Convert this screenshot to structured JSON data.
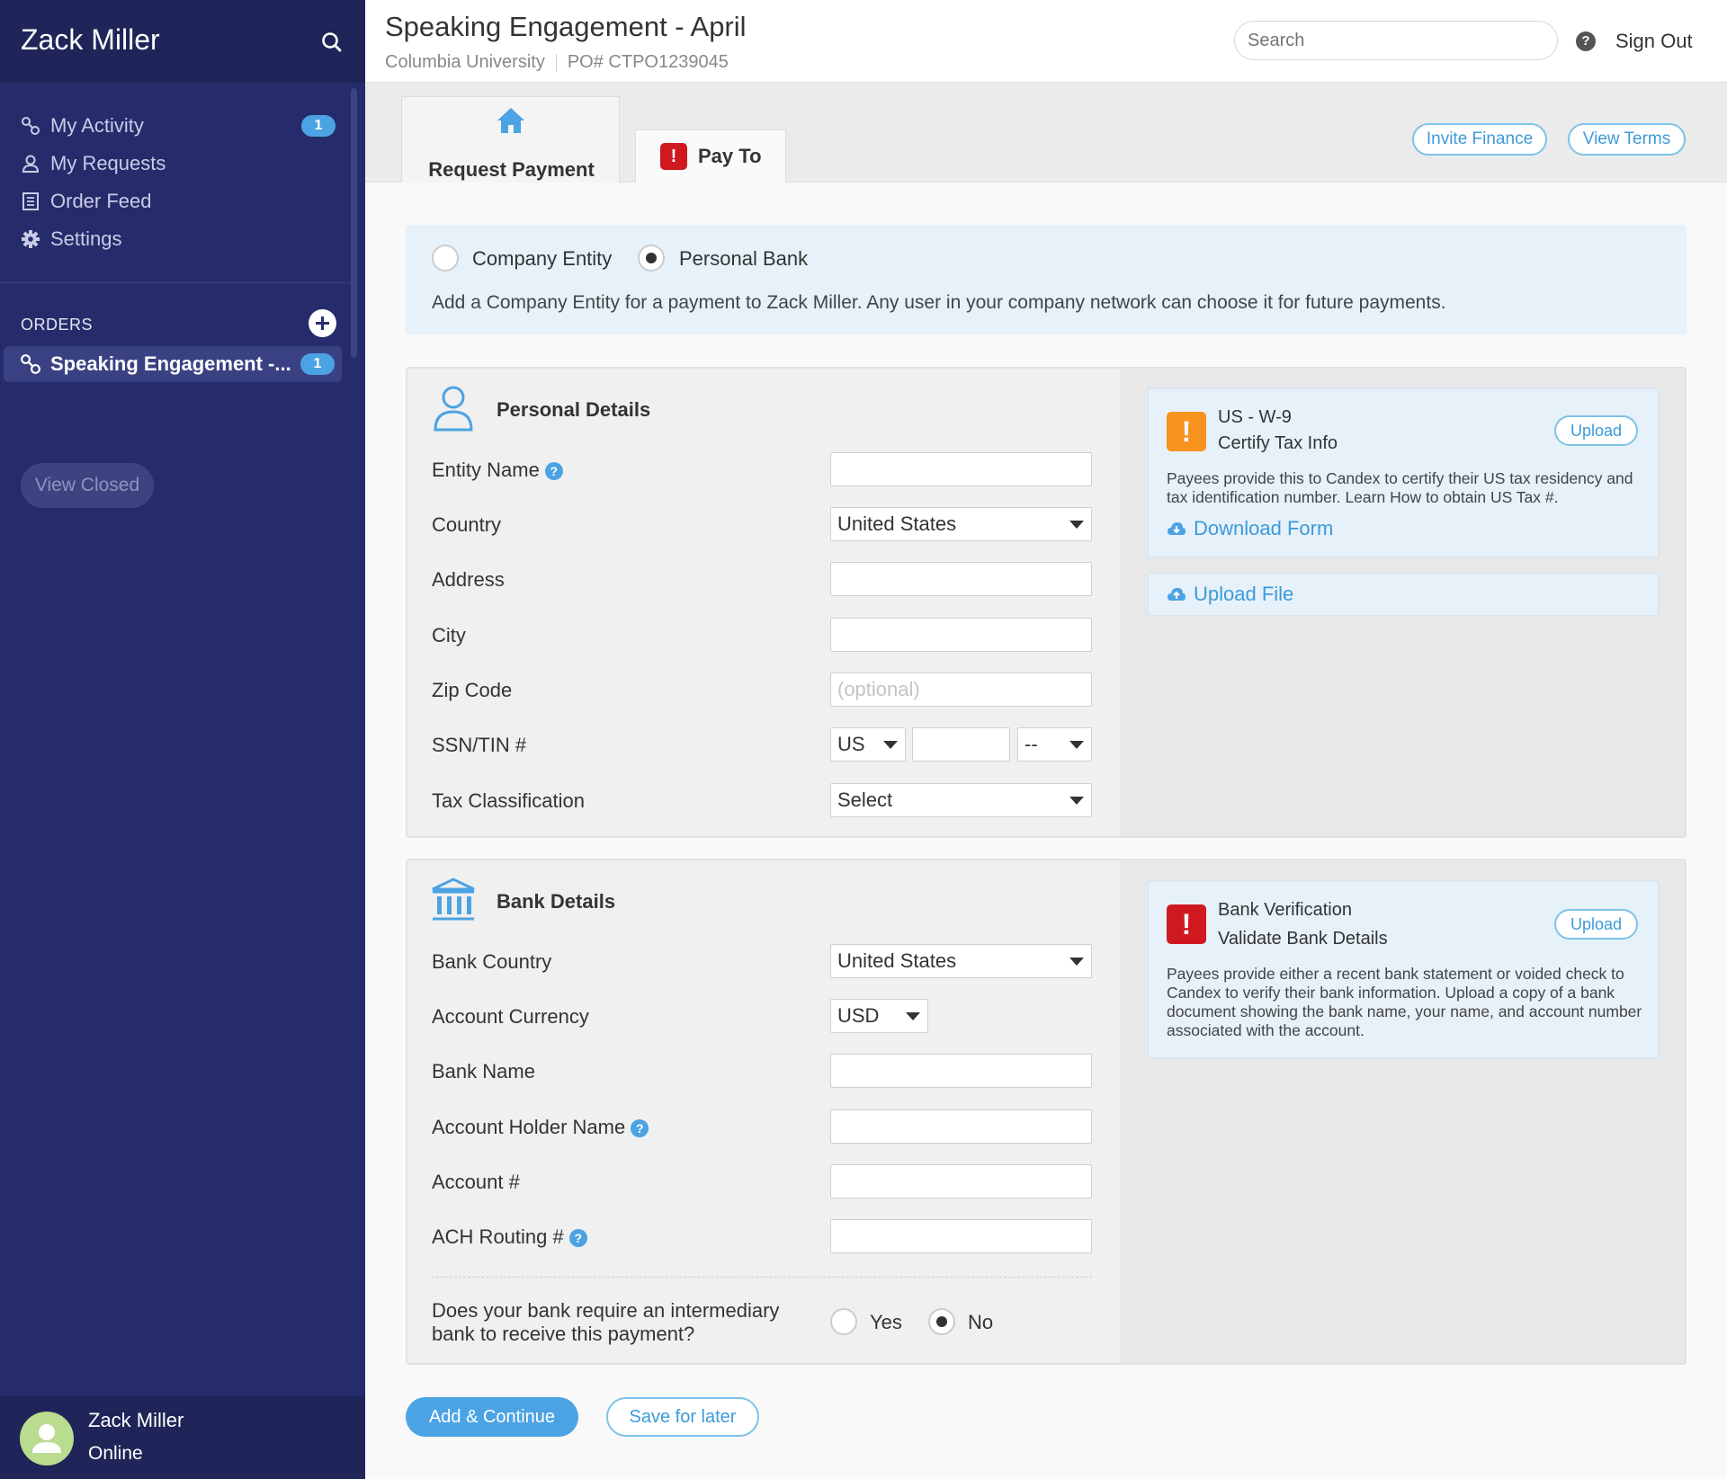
{
  "sidebar": {
    "user_name": "Zack Miller",
    "nav": [
      {
        "label": "My Activity",
        "icon": "link-icon",
        "badge": "1"
      },
      {
        "label": "My Requests",
        "icon": "user-icon"
      },
      {
        "label": "Order Feed",
        "icon": "list-icon"
      },
      {
        "label": "Settings",
        "icon": "gear-icon"
      }
    ],
    "orders_label": "ORDERS",
    "order_item": {
      "label": "Speaking Engagement -...",
      "badge": "1"
    },
    "view_closed": "View Closed",
    "footer": {
      "name": "Zack Miller",
      "status": "Online"
    }
  },
  "header": {
    "title": "Speaking Engagement - April",
    "org": "Columbia University",
    "po": "PO# CTPO1239045",
    "search_placeholder": "Search",
    "help": "?",
    "sign_out": "Sign Out"
  },
  "tabs": {
    "request_payment": "Request Payment",
    "pay_to": "Pay To",
    "pay_to_alert": "!",
    "invite_finance": "Invite Finance",
    "view_terms": "View Terms"
  },
  "entity": {
    "option_company": "Company Entity",
    "option_personal": "Personal Bank",
    "selected": "Personal Bank",
    "description": "Add a Company Entity for a payment to Zack Miller. Any user in your company network can choose it for future payments."
  },
  "personal": {
    "title": "Personal Details",
    "labels": {
      "entity_name": "Entity Name",
      "country": "Country",
      "address": "Address",
      "city": "City",
      "zip": "Zip Code",
      "ssn": "SSN/TIN #",
      "tax": "Tax Classification"
    },
    "values": {
      "country": "United States",
      "zip_placeholder": "(optional)",
      "ssn_country": "US",
      "ssn_suffix": "--",
      "tax": "Select"
    },
    "w9": {
      "alert": "!",
      "title": "US - W-9",
      "subtitle": "Certify Tax Info",
      "upload": "Upload",
      "description": "Payees provide this to Candex to certify their US tax residency and tax identification number.  Learn How to obtain US Tax #.",
      "download": "Download Form",
      "upload_file": "Upload File"
    }
  },
  "bank": {
    "title": "Bank Details",
    "labels": {
      "bank_country": "Bank Country",
      "currency": "Account Currency",
      "bank_name": "Bank Name",
      "holder": "Account Holder Name",
      "account": "Account #",
      "routing": "ACH Routing #",
      "intermediary": "Does your bank require an intermediary bank to receive this payment?"
    },
    "values": {
      "bank_country": "United States",
      "currency": "USD",
      "yes": "Yes",
      "no": "No",
      "intermediary_selected": "No"
    },
    "verification": {
      "alert": "!",
      "title": "Bank Verification",
      "subtitle": "Validate Bank Details",
      "upload": "Upload",
      "description": "Payees provide either a recent bank statement or voided check to Candex to verify their bank information. Upload a copy of a bank document showing the bank name, your name, and account number associated with the account."
    }
  },
  "actions": {
    "add_continue": "Add & Continue",
    "save_later": "Save for later"
  },
  "colors": {
    "sidebar": "#262c6b",
    "accent": "#4ba3e3",
    "alert_red": "#d0191f",
    "alert_orange": "#f7931e"
  }
}
